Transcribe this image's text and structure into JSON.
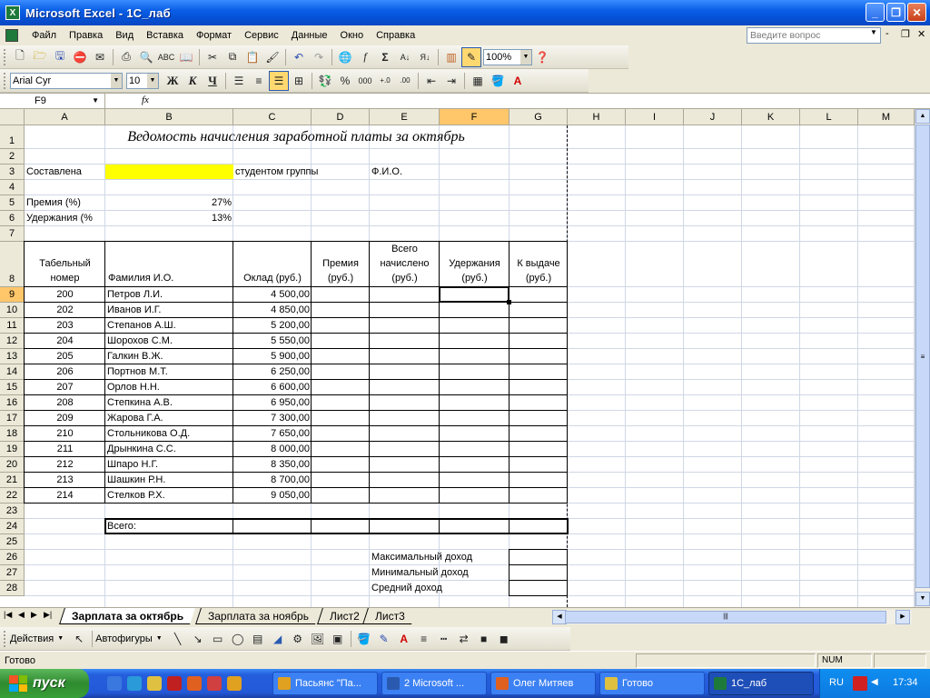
{
  "window": {
    "title": "Microsoft Excel - 1С_лаб",
    "icon_glyph": "X",
    "buttons": {
      "minimize": "_",
      "maximize": "❐",
      "close": "✕"
    }
  },
  "menubar": {
    "items": [
      "Файл",
      "Правка",
      "Вид",
      "Вставка",
      "Формат",
      "Сервис",
      "Данные",
      "Окно",
      "Справка"
    ],
    "help_placeholder": "Введите вопрос",
    "doc_controls": [
      "-",
      "❐",
      "✕"
    ]
  },
  "standard_toolbar": {
    "zoom": "100%"
  },
  "formatting_toolbar": {
    "font": "Arial Cyr",
    "size": "10",
    "bold": "Ж",
    "italic": "К",
    "underline": "Ч",
    "percent": "%",
    "thousands": "000"
  },
  "formula_bar": {
    "name_box": "F9",
    "fx": "fx",
    "content": ""
  },
  "columns": [
    "A",
    "B",
    "C",
    "D",
    "E",
    "F",
    "G",
    "H",
    "I",
    "J",
    "K",
    "L",
    "M"
  ],
  "selected_column": "F",
  "rows": [
    "1",
    "2",
    "3",
    "4",
    "5",
    "6",
    "7",
    "8",
    "9",
    "10",
    "11",
    "12",
    "13",
    "14",
    "15",
    "16",
    "17",
    "18",
    "19",
    "20",
    "21",
    "22",
    "23",
    "24",
    "25",
    "26",
    "27",
    "28"
  ],
  "selected_row": "9",
  "sheet": {
    "title": "Ведомость начисления заработной платы за октябрь",
    "compiled_label": "Составлена",
    "group_label": "студентом группы",
    "name_label": "Ф.И.О.",
    "bonus_label": "Премия (%)",
    "bonus_value": "27%",
    "deduct_label": "Удержания (%",
    "deduct_value": "13%",
    "headers": {
      "tab_no": "Табельный номер",
      "surname": "Фамилия И.О.",
      "salary": "Оклад (руб.)",
      "bonus": "Премия (руб.)",
      "total": "Всего начислено (руб.)",
      "deductions": "Удержания (руб.)",
      "payout": "К выдаче (руб.)"
    },
    "employees": [
      {
        "id": "200",
        "name": "Петров Л.И.",
        "salary": "4 500,00"
      },
      {
        "id": "202",
        "name": "Иванов И.Г.",
        "salary": "4 850,00"
      },
      {
        "id": "203",
        "name": "Степанов А.Ш.",
        "salary": "5 200,00"
      },
      {
        "id": "204",
        "name": "Шорохов С.М.",
        "salary": "5 550,00"
      },
      {
        "id": "205",
        "name": "Галкин В.Ж.",
        "salary": "5 900,00"
      },
      {
        "id": "206",
        "name": "Портнов М.Т.",
        "salary": "6 250,00"
      },
      {
        "id": "207",
        "name": "Орлов Н.Н.",
        "salary": "6 600,00"
      },
      {
        "id": "208",
        "name": "Степкина А.В.",
        "salary": "6 950,00"
      },
      {
        "id": "209",
        "name": "Жарова Г.А.",
        "salary": "7 300,00"
      },
      {
        "id": "210",
        "name": "Стольникова О.Д.",
        "salary": "7 650,00"
      },
      {
        "id": "211",
        "name": "Дрынкина С.С.",
        "salary": "8 000,00"
      },
      {
        "id": "212",
        "name": "Шпаро Н.Г.",
        "salary": "8 350,00"
      },
      {
        "id": "213",
        "name": "Шашкин Р.Н.",
        "salary": "8 700,00"
      },
      {
        "id": "214",
        "name": "Стелков Р.Х.",
        "salary": "9 050,00"
      }
    ],
    "total_label": "Всего:",
    "max_label": "Максимальный доход",
    "min_label": "Минимальный доход",
    "avg_label": "Средний доход",
    "highlight_color": "#ffff00"
  },
  "sheet_tabs": [
    "Зарплата за октябрь",
    "Зарплата за ноябрь",
    "Лист2",
    "Лист3"
  ],
  "active_tab": "Зарплата за октябрь",
  "drawing_toolbar": {
    "actions": "Действия",
    "autoshapes": "Автофигуры"
  },
  "status": {
    "text": "Готово",
    "num": "NUM"
  },
  "taskbar": {
    "start": "пуск",
    "tasks": [
      "Пасьянс \"Па...",
      "2 Microsoft ...",
      "Олег Митяев",
      "Готово",
      "1С_лаб"
    ],
    "lang": "RU",
    "time": "17:34"
  }
}
